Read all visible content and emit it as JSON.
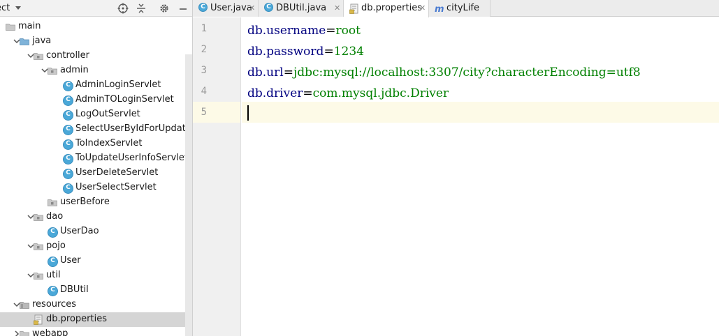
{
  "project_panel": {
    "title": "ect",
    "tree": [
      {
        "label": "main",
        "icon": "folder-icon",
        "expanded": true,
        "depth": 0
      },
      {
        "label": "java",
        "icon": "source-folder-icon",
        "expanded": true,
        "depth": 1
      },
      {
        "label": "controller",
        "icon": "package-icon",
        "expanded": true,
        "depth": 2
      },
      {
        "label": "admin",
        "icon": "package-icon",
        "expanded": true,
        "depth": 3
      },
      {
        "label": "AdminLoginServlet",
        "icon": "class-icon",
        "depth": 4
      },
      {
        "label": "AdminTOLoginServlet",
        "icon": "class-icon",
        "depth": 4
      },
      {
        "label": "LogOutServlet",
        "icon": "class-icon",
        "depth": 4
      },
      {
        "label": "SelectUserByIdForUpdateSer",
        "icon": "class-icon",
        "depth": 4
      },
      {
        "label": "ToIndexServlet",
        "icon": "class-icon",
        "depth": 4
      },
      {
        "label": "ToUpdateUserInfoServlet",
        "icon": "class-icon",
        "depth": 4
      },
      {
        "label": "UserDeleteServlet",
        "icon": "class-icon",
        "depth": 4
      },
      {
        "label": "UserSelectServlet",
        "icon": "class-icon",
        "depth": 4
      },
      {
        "label": "userBefore",
        "icon": "package-icon",
        "depth": 3
      },
      {
        "label": "dao",
        "icon": "package-icon",
        "expanded": true,
        "depth": 2
      },
      {
        "label": "UserDao",
        "icon": "class-icon",
        "depth": 3
      },
      {
        "label": "pojo",
        "icon": "package-icon",
        "expanded": true,
        "depth": 2
      },
      {
        "label": "User",
        "icon": "class-icon",
        "depth": 3
      },
      {
        "label": "util",
        "icon": "package-icon",
        "expanded": true,
        "depth": 2
      },
      {
        "label": "DBUtil",
        "icon": "class-icon",
        "depth": 3
      },
      {
        "label": "resources",
        "icon": "resources-folder-icon",
        "expanded": true,
        "depth": 1
      },
      {
        "label": "db.properties",
        "icon": "properties-file-icon",
        "depth": 2,
        "selected": true
      },
      {
        "label": "webapp",
        "icon": "folder-icon",
        "expanded": false,
        "depth": 1
      }
    ]
  },
  "tabs": [
    {
      "label": "User.java",
      "icon": "class-icon"
    },
    {
      "label": "DBUtil.java",
      "icon": "class-icon"
    },
    {
      "label": "db.properties",
      "icon": "properties-file-icon",
      "active": true
    },
    {
      "label": "cityLife",
      "icon": "maven-icon"
    }
  ],
  "editor": {
    "line_numbers": [
      "1",
      "2",
      "3",
      "4",
      "5"
    ],
    "lines": [
      {
        "key": "db.username",
        "sep": "=",
        "value": "root"
      },
      {
        "key": "db.password",
        "sep": "=",
        "value": "1234"
      },
      {
        "key": "db.url",
        "sep": "=",
        "value": "jdbc:mysql://localhost:3307/city?characterEncoding=utf8"
      },
      {
        "key": "db.driver",
        "sep": "=",
        "value": "com.mysql.jdbc.Driver"
      },
      {
        "key": "",
        "sep": "",
        "value": ""
      }
    ],
    "current_line": 5
  },
  "colors": {
    "key": "#000080",
    "value": "#008000",
    "class_icon": "#4aa8d8",
    "current_line_bg": "#fdfae7",
    "selection_bg": "#d5d5d5"
  }
}
